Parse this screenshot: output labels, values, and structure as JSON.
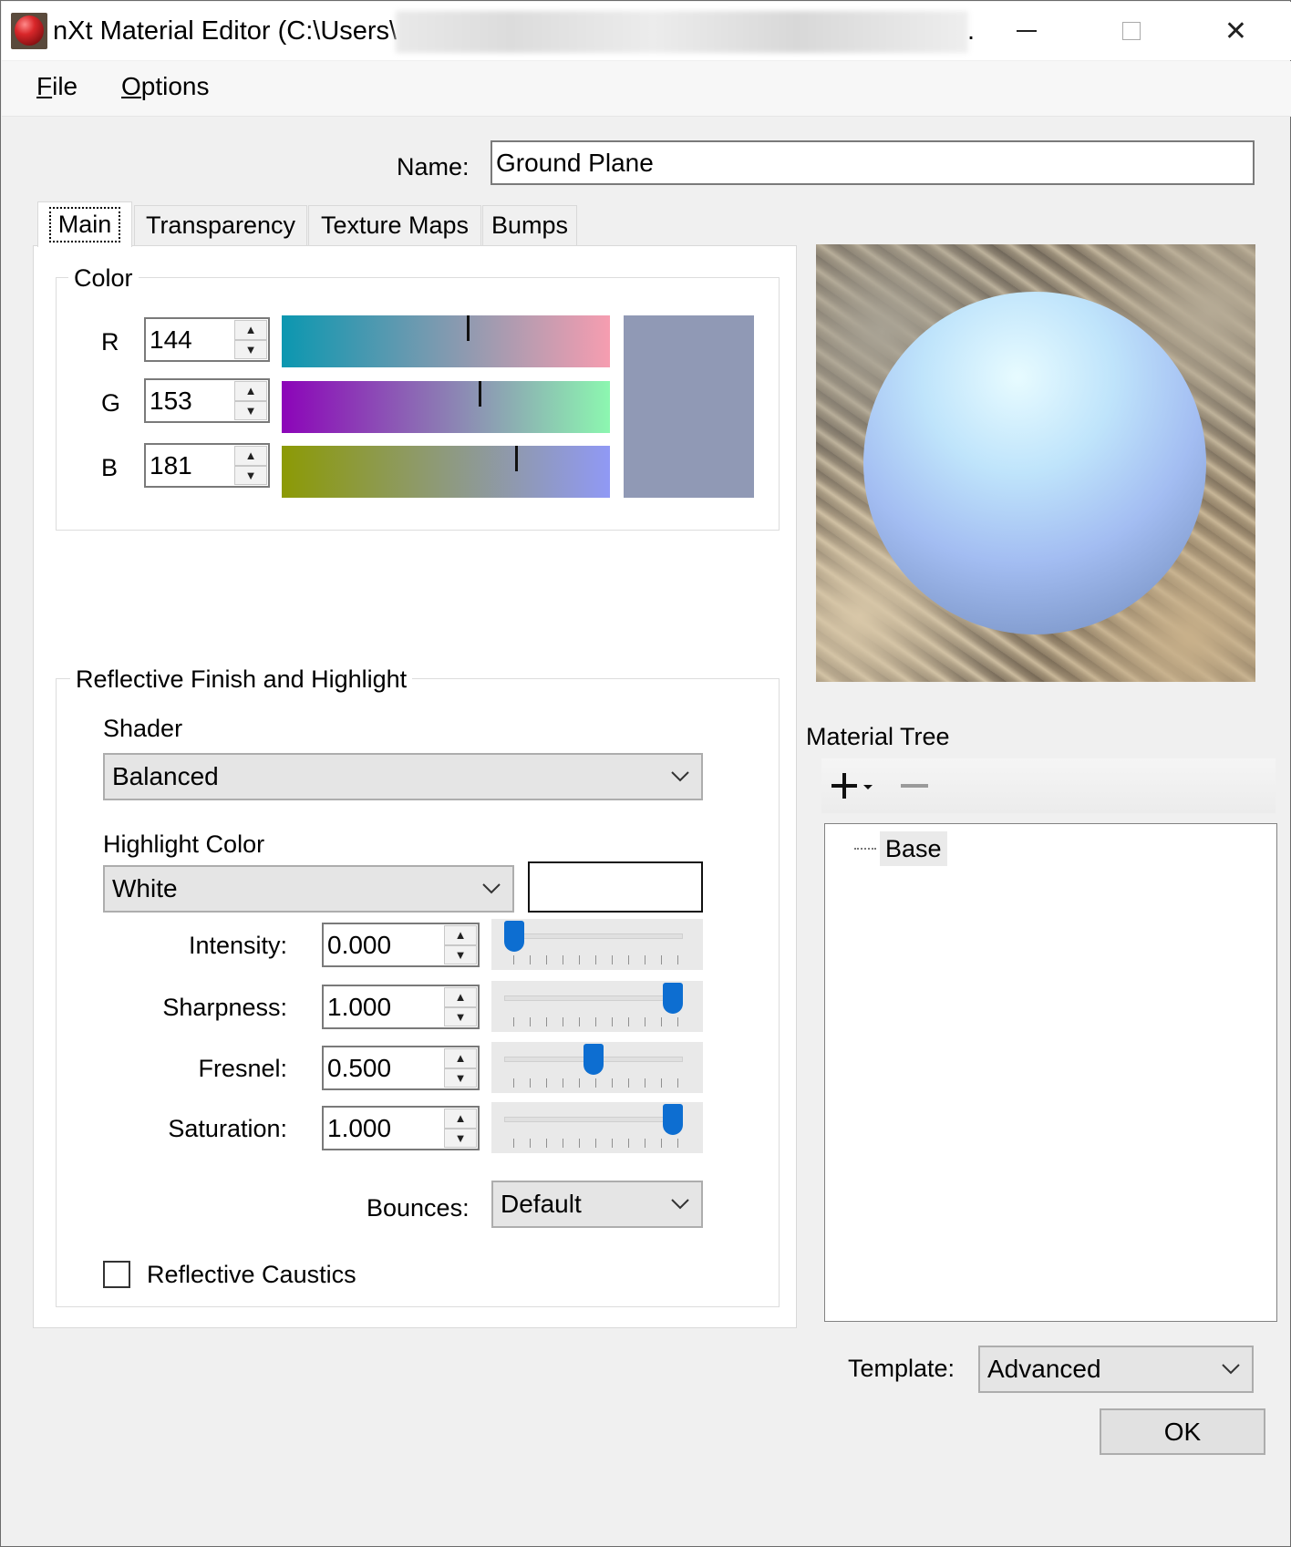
{
  "window": {
    "title": "nXt Material Editor (C:\\Users\\",
    "title_suffix": ".",
    "controls": {
      "minimize": "minimize",
      "maximize": "maximize",
      "close": "✕"
    }
  },
  "menu": [
    {
      "mnemonic": "F",
      "rest": "ile"
    },
    {
      "mnemonic": "O",
      "rest": "ptions"
    }
  ],
  "name_field": {
    "label": "Name:",
    "value": "Ground Plane"
  },
  "tabs": [
    {
      "label": "Main",
      "active": true
    },
    {
      "label": "Transparency",
      "active": false
    },
    {
      "label": "Texture Maps",
      "active": false
    },
    {
      "label": "Bumps",
      "active": false
    }
  ],
  "color": {
    "group_title": "Color",
    "channels": [
      {
        "label": "R",
        "value": "144",
        "fraction": 0.565
      },
      {
        "label": "G",
        "value": "153",
        "fraction": 0.6
      },
      {
        "label": "B",
        "value": "181",
        "fraction": 0.71
      }
    ],
    "swatch": "#9099b5"
  },
  "reflective": {
    "group_title": "Reflective Finish and Highlight",
    "shader_label": "Shader",
    "shader_value": "Balanced",
    "highlight_label": "Highlight Color",
    "highlight_value": "White",
    "highlight_swatch": "#ffffff",
    "sliders": [
      {
        "label": "Intensity:",
        "value": "0.000",
        "fraction": 0.0
      },
      {
        "label": "Sharpness:",
        "value": "1.000",
        "fraction": 1.0
      },
      {
        "label": "Fresnel:",
        "value": "0.500",
        "fraction": 0.5
      },
      {
        "label": "Saturation:",
        "value": "1.000",
        "fraction": 1.0
      }
    ],
    "bounces_label": "Bounces:",
    "bounces_value": "Default",
    "caustics_label": "Reflective Caustics",
    "caustics_checked": false
  },
  "material_tree": {
    "label": "Material Tree",
    "add_icon": "plus-icon",
    "remove_icon": "minus-icon",
    "items": [
      "Base"
    ]
  },
  "template": {
    "label": "Template:",
    "value": "Advanced"
  },
  "ok_label": "OK",
  "colors": {
    "accent": "#0d6ed1",
    "window_bg": "#f0f0f0"
  }
}
